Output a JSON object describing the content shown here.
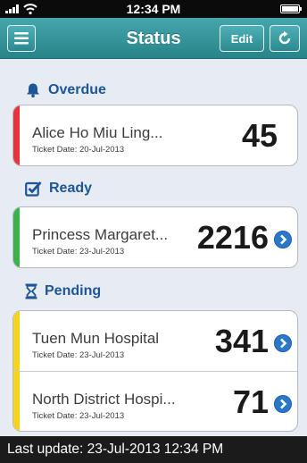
{
  "statusbar": {
    "time": "12:34 PM"
  },
  "header": {
    "title": "Status",
    "edit_label": "Edit"
  },
  "sections": {
    "overdue": {
      "title": "Overdue",
      "color": "#e8333a",
      "items": [
        {
          "name": "Alice Ho Miu Ling...",
          "ticket_date": "Ticket Date: 20-Jul-2013",
          "count": "45"
        }
      ]
    },
    "ready": {
      "title": "Ready",
      "color": "#3bb34a",
      "items": [
        {
          "name": "Princess Margaret...",
          "ticket_date": "Ticket Date: 23-Jul-2013",
          "count": "2216"
        }
      ]
    },
    "pending": {
      "title": "Pending",
      "color": "#f6d41b",
      "items": [
        {
          "name": "Tuen Mun Hospital",
          "ticket_date": "Ticket Date: 23-Jul-2013",
          "count": "341"
        },
        {
          "name": "North District Hospi...",
          "ticket_date": "Ticket Date: 23-Jul-2013",
          "count": "71"
        }
      ]
    }
  },
  "footer": {
    "last_update": "Last update: 23-Jul-2013 12:34 PM"
  },
  "colors": {
    "nav": "#2f8f95",
    "section_title": "#1e5596",
    "disclosure": "#2c78c8"
  },
  "icons": {
    "menu": "menu-icon",
    "refresh": "refresh-icon",
    "overdue": "bell-icon",
    "ready": "checkbox-icon",
    "pending": "hourglass-icon",
    "disclosure": "chevron-right-circle-icon"
  }
}
